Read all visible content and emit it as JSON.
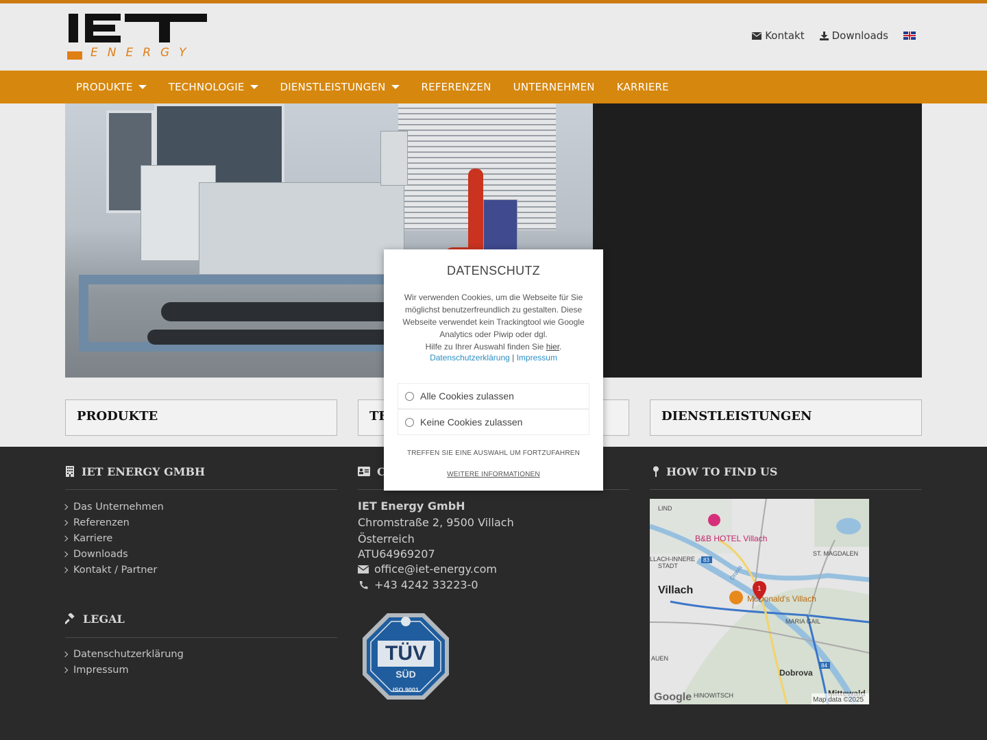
{
  "header": {
    "logo_main": "IET",
    "logo_sub": "ENERGY",
    "links": [
      {
        "label": "Kontakt",
        "icon": "envelope-icon"
      },
      {
        "label": "Downloads",
        "icon": "download-icon"
      }
    ],
    "language_flag": "uk-flag-icon"
  },
  "nav": {
    "items": [
      {
        "label": "PRODUKTE",
        "has_dropdown": true
      },
      {
        "label": "TECHNOLOGIE",
        "has_dropdown": true
      },
      {
        "label": "DIENSTLEISTUNGEN",
        "has_dropdown": true
      },
      {
        "label": "REFERENZEN",
        "has_dropdown": false
      },
      {
        "label": "UNTERNEHMEN",
        "has_dropdown": false
      },
      {
        "label": "KARRIERE",
        "has_dropdown": false
      }
    ]
  },
  "features": {
    "box1": "PRODUKTE",
    "box2": "TE",
    "box3": "DIENSTLEISTUNGEN"
  },
  "footer": {
    "col1": {
      "heading": "IET ENERGY GMBH",
      "items": [
        "Das Unternehmen",
        "Referenzen",
        "Karriere",
        "Downloads",
        "Kontakt / Partner"
      ]
    },
    "legal": {
      "heading": "LEGAL",
      "items": [
        "Datenschutzerklärung",
        "Impressum"
      ]
    },
    "col2": {
      "heading": "CO",
      "company": "IET Energy GmbH",
      "street": "Chromstraße 2,  9500  Villach",
      "country": "Österreich",
      "vat": "ATU64969207",
      "email": "office@iet-energy.com",
      "phone": "+43 4242 33223-0",
      "badge_main": "TÜV",
      "badge_sub": "SÜD",
      "badge_cert": "ISO 9001"
    },
    "col3": {
      "heading": "HOW TO FIND US",
      "map_labels": {
        "lind": "LIND",
        "hotel": "B&B HOTEL Villach",
        "magdalen": "ST. MAGDALEN",
        "innere1": "LLACH-INNERE",
        "innere2": "STADT",
        "city": "Villach",
        "mcdonalds": "McDonald's Villach",
        "maria": "MARIA GAIL",
        "auen": "AUEN",
        "dobrova": "Dobrova",
        "hinowitsch": "HINOWITSCH",
        "mittewald": "Mittewald",
        "drava": "Drava",
        "road83": "83",
        "road84": "84",
        "marker": "1",
        "google": "Google",
        "attribution": "Map data ©2025"
      }
    }
  },
  "cookie_modal": {
    "title": "DATENSCHUTZ",
    "text": "Wir verwenden Cookies, um die Webseite für Sie möglichst benutzerfreundlich zu gestalten. Diese Webseite verwendet kein Trackingtool wie Google Analytics oder Piwip oder dgl.",
    "help_prefix": "Hilfe zu Ihrer Auswahl finden Sie ",
    "help_link": "hier",
    "help_suffix": ".",
    "link_privacy": "Datenschutzerklärung",
    "link_sep": " | ",
    "link_imprint": "Impressum",
    "option_all": "Alle Cookies zulassen",
    "option_none": "Keine Cookies zulassen",
    "note": "TREFFEN SIE EINE AUSWAHL UM FORTZUFAHREN",
    "more": "WEITERE INFORMATIONEN"
  },
  "colors": {
    "accent": "#d6870e",
    "footer_bg": "#2a2a2a",
    "link_blue": "#2d8fc4"
  }
}
